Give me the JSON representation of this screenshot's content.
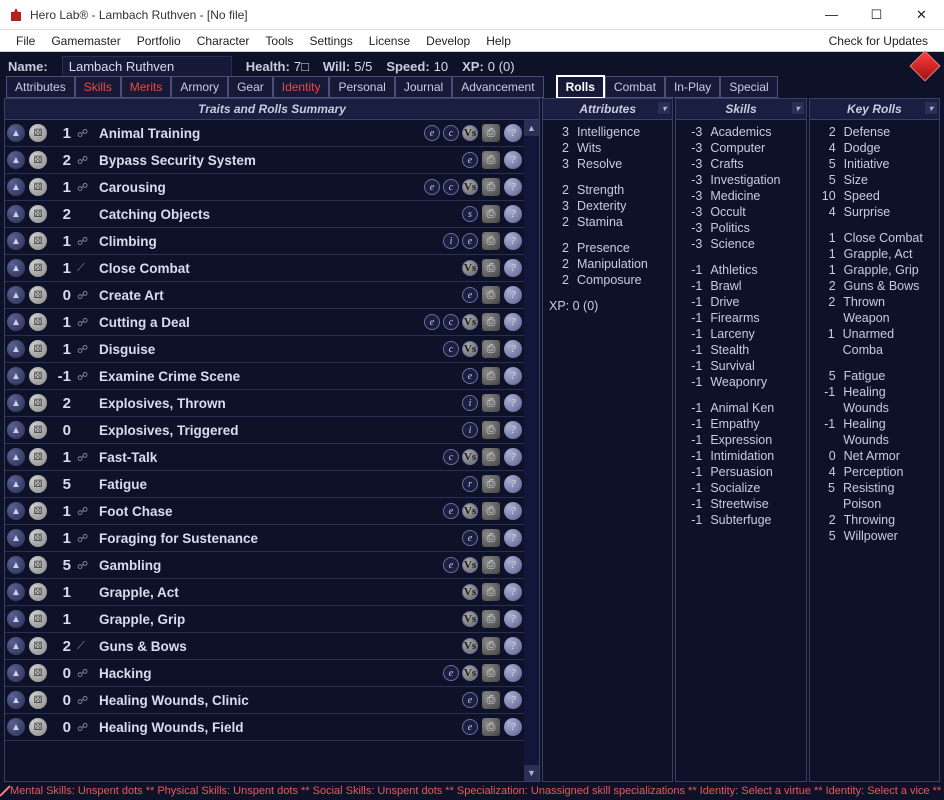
{
  "window": {
    "title": "Hero Lab® - Lambach Ruthven - [No file]"
  },
  "menubar": {
    "items": [
      "File",
      "Gamemaster",
      "Portfolio",
      "Character",
      "Tools",
      "Settings",
      "License",
      "Develop",
      "Help"
    ],
    "right": "Check for Updates"
  },
  "statbar": {
    "name_label": "Name:",
    "name_value": "Lambach Ruthven",
    "health_label": "Health:",
    "health_value": "7□",
    "will_label": "Will:",
    "will_value": "5/5",
    "speed_label": "Speed:",
    "speed_value": "10",
    "xp_label": "XP:",
    "xp_value": "0 (0)"
  },
  "tabs": {
    "left": [
      {
        "label": "Attributes",
        "highlight": false
      },
      {
        "label": "Skills",
        "highlight": true
      },
      {
        "label": "Merits",
        "highlight": true
      },
      {
        "label": "Armory",
        "highlight": false
      },
      {
        "label": "Gear",
        "highlight": false
      },
      {
        "label": "Identity",
        "highlight": true
      },
      {
        "label": "Personal",
        "highlight": false
      },
      {
        "label": "Journal",
        "highlight": false
      },
      {
        "label": "Advancement",
        "highlight": false
      }
    ],
    "right": [
      {
        "label": "Rolls",
        "active": true
      },
      {
        "label": "Combat",
        "active": false
      },
      {
        "label": "In-Play",
        "active": false
      },
      {
        "label": "Special",
        "active": false
      }
    ]
  },
  "traits_panel": {
    "title": "Traits and Rolls Summary",
    "rows": [
      {
        "val": "1",
        "mark": "☍",
        "name": "Animal Training",
        "mods": [
          "e",
          "c"
        ],
        "vs": true
      },
      {
        "val": "2",
        "mark": "☍",
        "name": "Bypass Security System",
        "mods": [
          "e"
        ],
        "vs": false
      },
      {
        "val": "1",
        "mark": "☍",
        "name": "Carousing",
        "mods": [
          "e",
          "c"
        ],
        "vs": true
      },
      {
        "val": "2",
        "mark": "",
        "name": "Catching Objects",
        "mods": [
          "s"
        ],
        "vs": false
      },
      {
        "val": "1",
        "mark": "☍",
        "name": "Climbing",
        "mods": [
          "i",
          "e"
        ],
        "vs": false
      },
      {
        "val": "1",
        "mark": "⟋",
        "name": "Close Combat",
        "mods": [],
        "vs": true
      },
      {
        "val": "0",
        "mark": "☍",
        "name": "Create Art",
        "mods": [
          "e"
        ],
        "vs": false
      },
      {
        "val": "1",
        "mark": "☍",
        "name": "Cutting a Deal",
        "mods": [
          "e",
          "c"
        ],
        "vs": true
      },
      {
        "val": "1",
        "mark": "☍",
        "name": "Disguise",
        "mods": [
          "c"
        ],
        "vs": true
      },
      {
        "val": "-1",
        "mark": "☍",
        "name": "Examine Crime Scene",
        "mods": [
          "e"
        ],
        "vs": false
      },
      {
        "val": "2",
        "mark": "",
        "name": "Explosives, Thrown",
        "mods": [
          "i"
        ],
        "vs": false
      },
      {
        "val": "0",
        "mark": "",
        "name": "Explosives, Triggered",
        "mods": [
          "i"
        ],
        "vs": false
      },
      {
        "val": "1",
        "mark": "☍",
        "name": "Fast-Talk",
        "mods": [
          "c"
        ],
        "vs": true
      },
      {
        "val": "5",
        "mark": "",
        "name": "Fatigue",
        "mods": [
          "r"
        ],
        "vs": false
      },
      {
        "val": "1",
        "mark": "☍",
        "name": "Foot Chase",
        "mods": [
          "e"
        ],
        "vs": true
      },
      {
        "val": "1",
        "mark": "☍",
        "name": "Foraging for Sustenance",
        "mods": [
          "e"
        ],
        "vs": false
      },
      {
        "val": "5",
        "mark": "☍",
        "name": "Gambling",
        "mods": [
          "e"
        ],
        "vs": true
      },
      {
        "val": "1",
        "mark": "",
        "name": "Grapple, Act",
        "mods": [],
        "vs": true
      },
      {
        "val": "1",
        "mark": "",
        "name": "Grapple, Grip",
        "mods": [],
        "vs": true
      },
      {
        "val": "2",
        "mark": "⟋",
        "name": "Guns & Bows",
        "mods": [],
        "vs": true
      },
      {
        "val": "0",
        "mark": "☍",
        "name": "Hacking",
        "mods": [
          "e"
        ],
        "vs": true
      },
      {
        "val": "0",
        "mark": "☍",
        "name": "Healing Wounds, Clinic",
        "mods": [
          "e"
        ],
        "vs": false
      },
      {
        "val": "0",
        "mark": "☍",
        "name": "Healing Wounds, Field",
        "mods": [
          "e"
        ],
        "vs": false
      }
    ]
  },
  "columns": {
    "attributes": {
      "title": "Attributes",
      "groups": [
        [
          {
            "v": "3",
            "n": "Intelligence"
          },
          {
            "v": "2",
            "n": "Wits"
          },
          {
            "v": "3",
            "n": "Resolve"
          }
        ],
        [
          {
            "v": "2",
            "n": "Strength"
          },
          {
            "v": "3",
            "n": "Dexterity"
          },
          {
            "v": "2",
            "n": "Stamina"
          }
        ],
        [
          {
            "v": "2",
            "n": "Presence"
          },
          {
            "v": "2",
            "n": "Manipulation"
          },
          {
            "v": "2",
            "n": "Composure"
          }
        ]
      ],
      "xp_line": "XP: 0 (0)"
    },
    "skills": {
      "title": "Skills",
      "groups": [
        [
          {
            "v": "-3",
            "n": "Academics"
          },
          {
            "v": "-3",
            "n": "Computer"
          },
          {
            "v": "-3",
            "n": "Crafts"
          },
          {
            "v": "-3",
            "n": "Investigation"
          },
          {
            "v": "-3",
            "n": "Medicine"
          },
          {
            "v": "-3",
            "n": "Occult"
          },
          {
            "v": "-3",
            "n": "Politics"
          },
          {
            "v": "-3",
            "n": "Science"
          }
        ],
        [
          {
            "v": "-1",
            "n": "Athletics"
          },
          {
            "v": "-1",
            "n": "Brawl"
          },
          {
            "v": "-1",
            "n": "Drive"
          },
          {
            "v": "-1",
            "n": "Firearms"
          },
          {
            "v": "-1",
            "n": "Larceny"
          },
          {
            "v": "-1",
            "n": "Stealth"
          },
          {
            "v": "-1",
            "n": "Survival"
          },
          {
            "v": "-1",
            "n": "Weaponry"
          }
        ],
        [
          {
            "v": "-1",
            "n": "Animal Ken"
          },
          {
            "v": "-1",
            "n": "Empathy"
          },
          {
            "v": "-1",
            "n": "Expression"
          },
          {
            "v": "-1",
            "n": "Intimidation"
          },
          {
            "v": "-1",
            "n": "Persuasion"
          },
          {
            "v": "-1",
            "n": "Socialize"
          },
          {
            "v": "-1",
            "n": "Streetwise"
          },
          {
            "v": "-1",
            "n": "Subterfuge"
          }
        ]
      ]
    },
    "keyrolls": {
      "title": "Key Rolls",
      "groups": [
        [
          {
            "v": "2",
            "n": "Defense"
          },
          {
            "v": "4",
            "n": "Dodge"
          },
          {
            "v": "5",
            "n": "Initiative"
          },
          {
            "v": "5",
            "n": "Size"
          },
          {
            "v": "10",
            "n": "Speed"
          },
          {
            "v": "4",
            "n": "Surprise"
          }
        ],
        [
          {
            "v": "1",
            "n": "Close Combat"
          },
          {
            "v": "1",
            "n": "Grapple, Act"
          },
          {
            "v": "1",
            "n": "Grapple, Grip"
          },
          {
            "v": "2",
            "n": "Guns & Bows"
          },
          {
            "v": "2",
            "n": "Thrown Weapon"
          },
          {
            "v": "1",
            "n": "Unarmed Comba"
          }
        ],
        [
          {
            "v": "5",
            "n": "Fatigue"
          },
          {
            "v": "-1",
            "n": "Healing Wounds"
          },
          {
            "v": "-1",
            "n": "Healing Wounds"
          },
          {
            "v": "0",
            "n": "Net Armor"
          },
          {
            "v": "4",
            "n": "Perception"
          },
          {
            "v": "5",
            "n": "Resisting Poison"
          },
          {
            "v": "2",
            "n": "Throwing"
          },
          {
            "v": "5",
            "n": "Willpower"
          }
        ]
      ]
    }
  },
  "footer": {
    "text": "Mental Skills: Unspent dots ** Physical Skills: Unspent dots ** Social Skills: Unspent dots ** Specialization: Unassigned skill specializations ** Identity: Select a virtue ** Identity: Select a vice **"
  }
}
